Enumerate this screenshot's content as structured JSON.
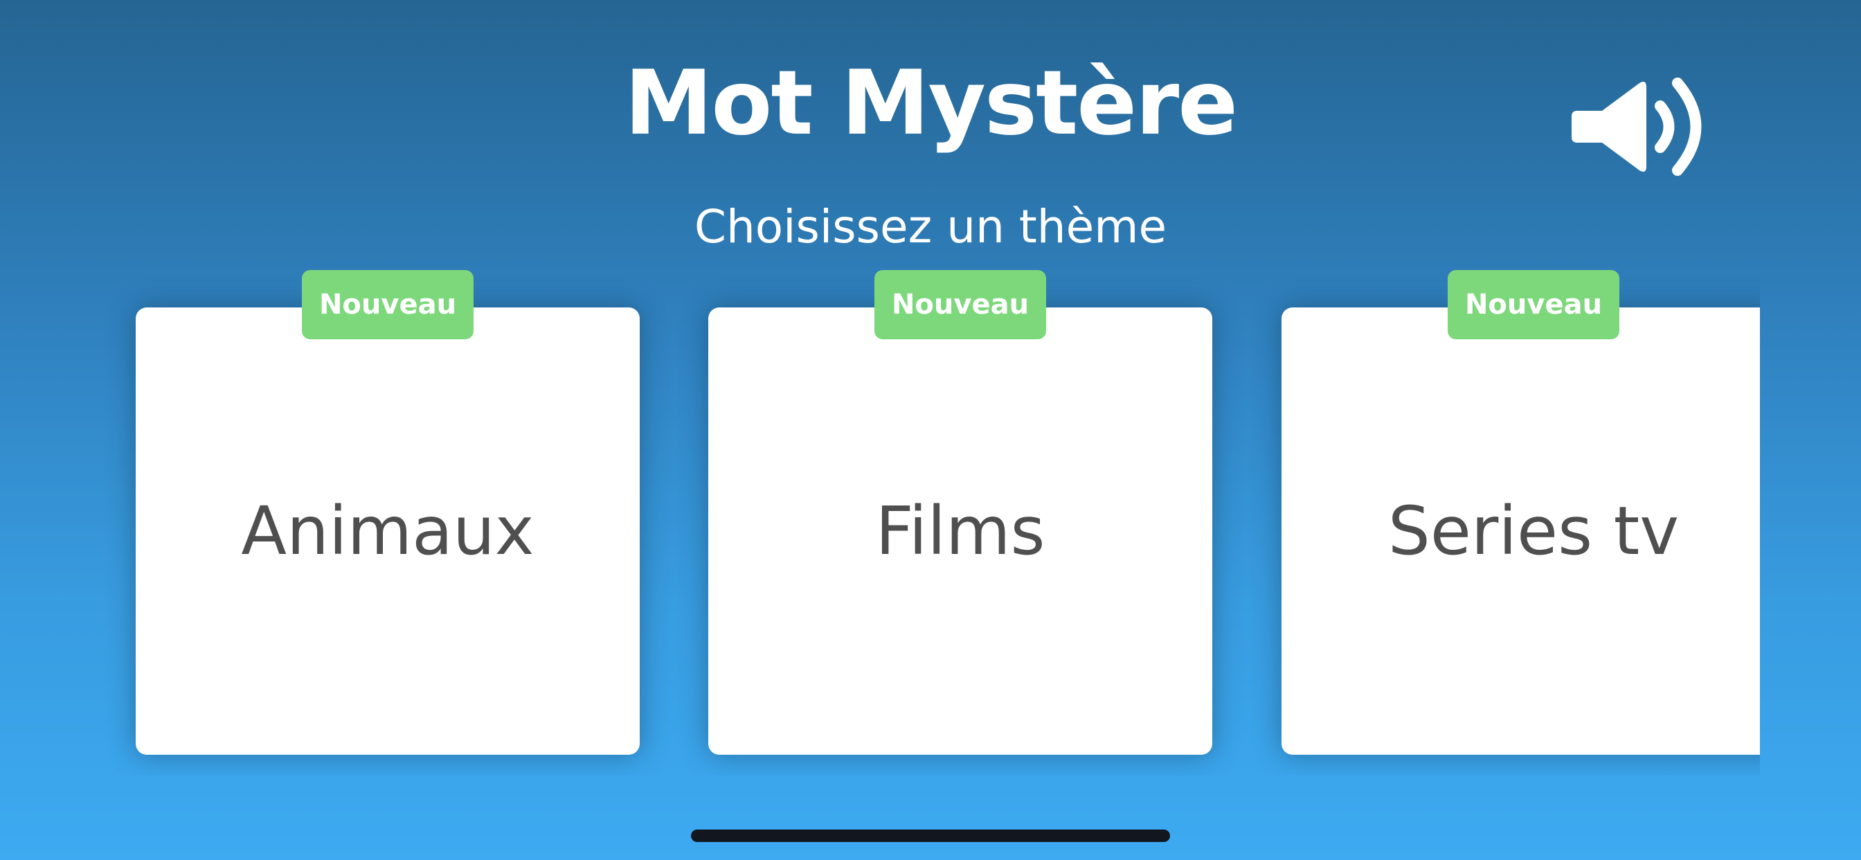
{
  "app": {
    "title": "Mot Mystère",
    "subtitle": "Choisissez un thème"
  },
  "sound": {
    "icon": "speaker-volume-icon",
    "state": "on"
  },
  "themes": [
    {
      "label": "Animaux",
      "badge": "Nouveau"
    },
    {
      "label": "Films",
      "badge": "Nouveau"
    },
    {
      "label": "Series tv",
      "badge": "Nouveau"
    }
  ],
  "colors": {
    "background_top": "#256593",
    "background_bottom": "#3daaf1",
    "card": "#ffffff",
    "card_text": "#4f4f4f",
    "badge": "#7dd87b",
    "badge_text": "#ffffff",
    "title_text": "#ffffff"
  }
}
